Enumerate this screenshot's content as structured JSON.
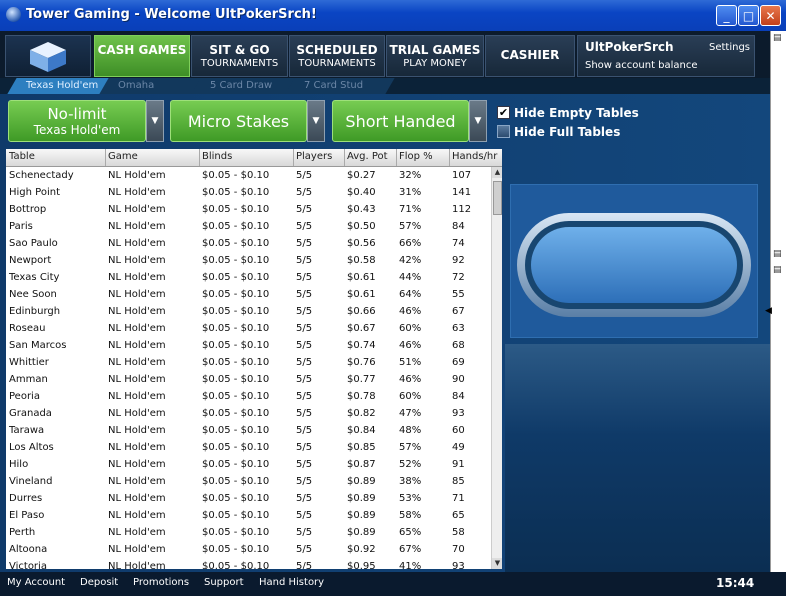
{
  "window": {
    "title": "Tower Gaming - Welcome UltPokerSrch!",
    "minimize": "_",
    "maximize": "□",
    "close": "✕"
  },
  "nav": {
    "tabs": [
      {
        "line1": "CASH GAMES",
        "line2": ""
      },
      {
        "line1": "SIT & GO",
        "line2": "TOURNAMENTS"
      },
      {
        "line1": "SCHEDULED",
        "line2": "TOURNAMENTS"
      },
      {
        "line1": "TRIAL GAMES",
        "line2": "PLAY MONEY"
      },
      {
        "line1": "CASHIER",
        "line2": ""
      }
    ],
    "account": {
      "username": "UltPokerSrch",
      "settings": "Settings",
      "balance_link": "Show account balance"
    }
  },
  "subtabs": [
    "Texas Hold'em",
    "Omaha",
    "5 Card Draw",
    "7 Card Stud"
  ],
  "filters": {
    "limit": {
      "line1": "No-limit",
      "line2": "Texas Hold'em"
    },
    "stakes": "Micro Stakes",
    "seats": "Short Handed",
    "dropdown_arrow": "▼",
    "hide_empty": {
      "label": "Hide Empty Tables",
      "checked": "✔"
    },
    "hide_full": {
      "label": "Hide Full Tables"
    }
  },
  "table": {
    "columns": [
      "Table",
      "Game",
      "Blinds",
      "Players",
      "Avg. Pot",
      "Flop %",
      "Hands/hr"
    ],
    "rows": [
      [
        "Schenectady",
        "NL Hold'em",
        "$0.05 - $0.10",
        "5/5",
        "$0.27",
        "32%",
        "107"
      ],
      [
        "High Point",
        "NL Hold'em",
        "$0.05 - $0.10",
        "5/5",
        "$0.40",
        "31%",
        "141"
      ],
      [
        "Bottrop",
        "NL Hold'em",
        "$0.05 - $0.10",
        "5/5",
        "$0.43",
        "71%",
        "112"
      ],
      [
        "Paris",
        "NL Hold'em",
        "$0.05 - $0.10",
        "5/5",
        "$0.50",
        "57%",
        "84"
      ],
      [
        "Sao Paulo",
        "NL Hold'em",
        "$0.05 - $0.10",
        "5/5",
        "$0.56",
        "66%",
        "74"
      ],
      [
        "Newport",
        "NL Hold'em",
        "$0.05 - $0.10",
        "5/5",
        "$0.58",
        "42%",
        "92"
      ],
      [
        "Texas City",
        "NL Hold'em",
        "$0.05 - $0.10",
        "5/5",
        "$0.61",
        "44%",
        "72"
      ],
      [
        "Nee Soon",
        "NL Hold'em",
        "$0.05 - $0.10",
        "5/5",
        "$0.61",
        "64%",
        "55"
      ],
      [
        "Edinburgh",
        "NL Hold'em",
        "$0.05 - $0.10",
        "5/5",
        "$0.66",
        "46%",
        "67"
      ],
      [
        "Roseau",
        "NL Hold'em",
        "$0.05 - $0.10",
        "5/5",
        "$0.67",
        "60%",
        "63"
      ],
      [
        "San Marcos",
        "NL Hold'em",
        "$0.05 - $0.10",
        "5/5",
        "$0.74",
        "46%",
        "68"
      ],
      [
        "Whittier",
        "NL Hold'em",
        "$0.05 - $0.10",
        "5/5",
        "$0.76",
        "51%",
        "69"
      ],
      [
        "Amman",
        "NL Hold'em",
        "$0.05 - $0.10",
        "5/5",
        "$0.77",
        "46%",
        "90"
      ],
      [
        "Peoria",
        "NL Hold'em",
        "$0.05 - $0.10",
        "5/5",
        "$0.78",
        "60%",
        "84"
      ],
      [
        "Granada",
        "NL Hold'em",
        "$0.05 - $0.10",
        "5/5",
        "$0.82",
        "47%",
        "93"
      ],
      [
        "Tarawa",
        "NL Hold'em",
        "$0.05 - $0.10",
        "5/5",
        "$0.84",
        "48%",
        "60"
      ],
      [
        "Los Altos",
        "NL Hold'em",
        "$0.05 - $0.10",
        "5/5",
        "$0.85",
        "57%",
        "49"
      ],
      [
        "Hilo",
        "NL Hold'em",
        "$0.05 - $0.10",
        "5/5",
        "$0.87",
        "52%",
        "91"
      ],
      [
        "Vineland",
        "NL Hold'em",
        "$0.05 - $0.10",
        "5/5",
        "$0.89",
        "38%",
        "85"
      ],
      [
        "Durres",
        "NL Hold'em",
        "$0.05 - $0.10",
        "5/5",
        "$0.89",
        "53%",
        "71"
      ],
      [
        "El Paso",
        "NL Hold'em",
        "$0.05 - $0.10",
        "5/5",
        "$0.89",
        "58%",
        "65"
      ],
      [
        "Perth",
        "NL Hold'em",
        "$0.05 - $0.10",
        "5/5",
        "$0.89",
        "65%",
        "58"
      ],
      [
        "Altoona",
        "NL Hold'em",
        "$0.05 - $0.10",
        "5/5",
        "$0.92",
        "67%",
        "70"
      ],
      [
        "Victoria",
        "NL Hold'em",
        "$0.05 - $0.10",
        "5/5",
        "$0.95",
        "41%",
        "93"
      ]
    ]
  },
  "scroll": {
    "up": "▲",
    "down": "▼"
  },
  "bottom": {
    "links": [
      "My Account",
      "Deposit",
      "Promotions",
      "Support",
      "Hand History"
    ],
    "clock": "15:44"
  },
  "colors": {
    "accent_green": "#5cb33a",
    "title_blue": "#0a45c4",
    "nav_dark": "#0c1b2c"
  }
}
